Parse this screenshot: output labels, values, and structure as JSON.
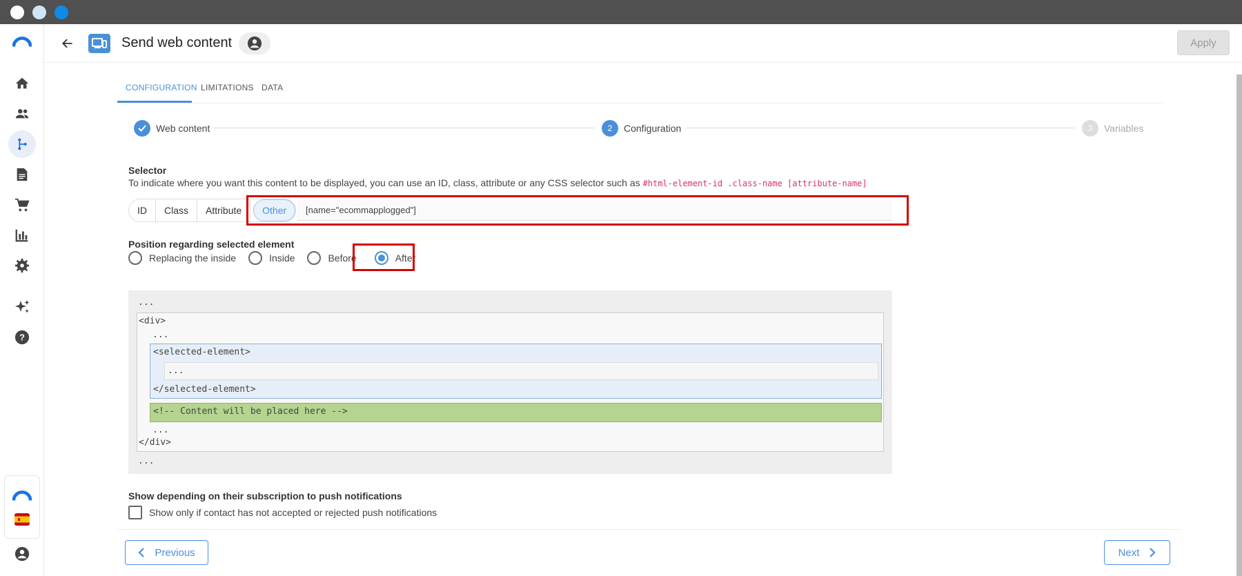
{
  "header": {
    "title": "Send web content",
    "apply_label": "Apply"
  },
  "tabs": [
    {
      "label": "CONFIGURATION",
      "active": true
    },
    {
      "label": "LIMITATIONS",
      "active": false
    },
    {
      "label": "DATA",
      "active": false
    }
  ],
  "stepper": {
    "steps": [
      {
        "number": "✓",
        "label": "Web content",
        "state": "done"
      },
      {
        "number": "2",
        "label": "Configuration",
        "state": "current"
      },
      {
        "number": "3",
        "label": "Variables",
        "state": "pending"
      }
    ]
  },
  "selector": {
    "label": "Selector",
    "help_text": "To indicate where you want this content to be displayed, you can use an ID, class, attribute or any CSS selector such as",
    "example_code": "#html-element-id .class-name [attribute-name]",
    "options": [
      "ID",
      "Class",
      "Attribute",
      "Other"
    ],
    "selected": "Other",
    "value": "[name=\"ecommapplogged\"]"
  },
  "position": {
    "label": "Position regarding selected element",
    "options": [
      "Replacing the inside",
      "Inside",
      "Before",
      "After"
    ],
    "selected": "After"
  },
  "preview": {
    "ellipsis": "...",
    "div_open": "<div>",
    "div_close": "</div>",
    "selected_open": "<selected-element>",
    "selected_close": "</selected-element>",
    "content_placeholder": "<!-- Content will be placed here -->"
  },
  "push": {
    "label": "Show depending on their subscription to push notifications",
    "checkbox_label": "Show only if contact has not accepted or rejected push notifications",
    "checked": false
  },
  "footer": {
    "previous_label": "Previous",
    "next_label": "Next"
  },
  "colors": {
    "accent": "#4a90d9",
    "highlight": "#d40000",
    "content_green": "#b5d48f"
  },
  "sidebar": {
    "icons": [
      "logo-icon",
      "home-icon",
      "contacts-icon",
      "automation-icon",
      "document-icon",
      "cart-icon",
      "reports-icon",
      "settings-icon",
      "sparkle-icon",
      "help-icon",
      "account-logo-icon",
      "spain-flag-icon",
      "user-icon"
    ]
  }
}
